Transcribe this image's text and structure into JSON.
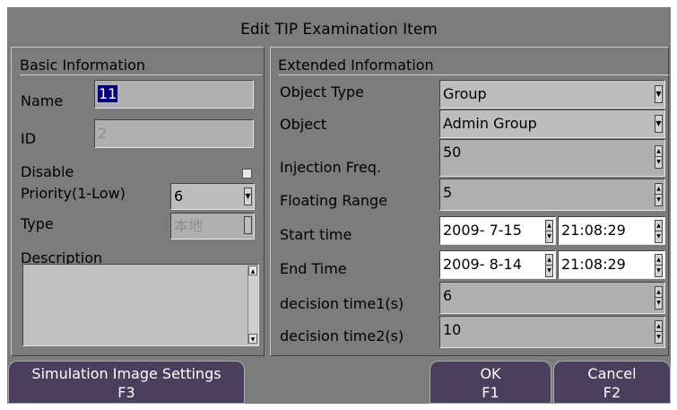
{
  "dialog": {
    "title": "Edit TIP Examination Item"
  },
  "basic": {
    "heading": "Basic Information",
    "name_label": "Name",
    "name_value": "11",
    "id_label": "ID",
    "id_value": "2",
    "disable_label": "Disable",
    "priority_label": "Priority(1-Low)",
    "priority_value": "6",
    "type_label": "Type",
    "type_value": "本地",
    "description_label": "Description",
    "description_value": ""
  },
  "extended": {
    "heading": "Extended Information",
    "object_type_label": "Object Type",
    "object_type_value": "Group",
    "object_label": "Object",
    "object_value": "Admin Group",
    "injection_freq_label": "Injection Freq.",
    "injection_freq_value": "50",
    "floating_range_label": "Floating Range",
    "floating_range_value": "5",
    "start_time_label": "Start time",
    "start_date": "2009-  7-15",
    "start_clock": "21:08:29",
    "end_time_label": "End Time",
    "end_date": "2009-  8-14",
    "end_clock": "21:08:29",
    "decision1_label": "decision time1(s)",
    "decision1_value": "6",
    "decision2_label": "decision time2(s)",
    "decision2_value": "10"
  },
  "buttons": {
    "simulation_line1": "Simulation Image Settings",
    "simulation_line2": "F3",
    "ok_line1": "OK",
    "ok_line2": "F1",
    "cancel_line1": "Cancel",
    "cancel_line2": "F2"
  },
  "colors": {
    "dialog_bg": "#7c7c7c",
    "field_bg": "#b0b0b0",
    "button_bg": "#4a3f5c",
    "selection": "#000080"
  }
}
